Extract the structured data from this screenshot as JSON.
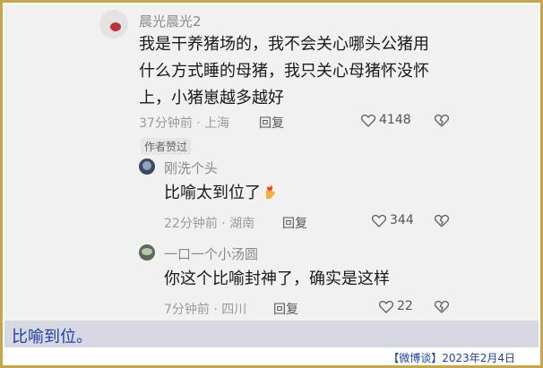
{
  "comments": [
    {
      "username": "晨光晨光2",
      "text_lines": [
        "我是干养猪场的，我不会关心哪头公猪用",
        "什么方式睡的母猪，我只关心母猪怀没怀",
        "上，小猪崽越多越好"
      ],
      "meta": "37分钟前 · 上海",
      "reply_label": "回复",
      "likes": "4148",
      "badge": "作者赞过"
    },
    {
      "username": "刚洗个头",
      "text": "比喻太到位了",
      "meta": "22分钟前 · 湖南",
      "reply_label": "回复",
      "likes": "344"
    },
    {
      "username": "一口一个小汤圆",
      "text": "你这个比喻封神了，确实是这样",
      "meta": "7分钟前 · 四川",
      "reply_label": "回复",
      "likes": "22"
    }
  ],
  "caption": "比喻到位。",
  "source": "【微博谈】2023年2月4日",
  "colors": {
    "border": "#c9a54a",
    "caption_text": "#1f3fa8",
    "caption_bg": "#d8d8e2"
  }
}
